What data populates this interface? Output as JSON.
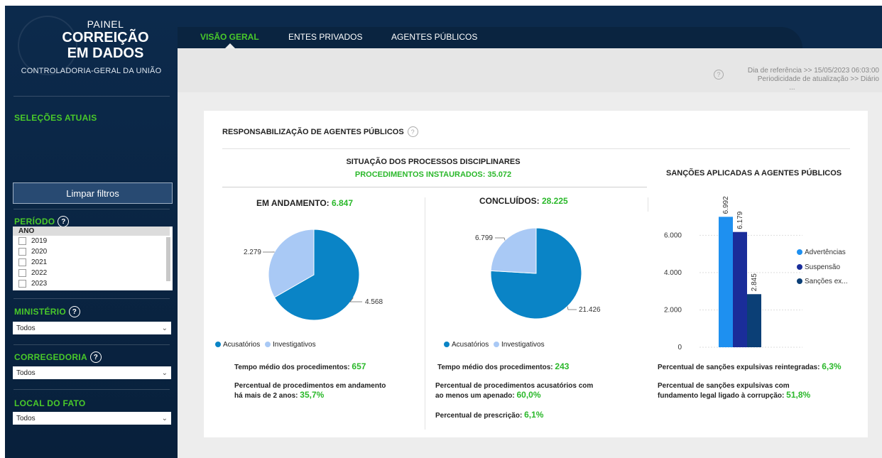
{
  "sidebar": {
    "brand_line1": "PAINEL",
    "brand_line2": "CORREIÇÃO",
    "brand_line3": "EM DADOS",
    "brand_line4": "CONTROLADORIA-GERAL DA UNIÃO",
    "selections_title": "SELEÇÕES ATUAIS",
    "clear_filters": "Limpar filtros",
    "periodo_title": "PERÍODO",
    "ano_header": "ANO",
    "years": [
      "2019",
      "2020",
      "2021",
      "2022",
      "2023"
    ],
    "ministerio_title": "MINISTÉRIO",
    "ministerio_value": "Todos",
    "corregedoria_title": "CORREGEDORIA",
    "corregedoria_value": "Todos",
    "local_title": "LOCAL DO FATO",
    "local_value": "Todos",
    "help_glyph": "?"
  },
  "nav": {
    "tabs": [
      "VISÃO GERAL",
      "ENTES PRIVADOS",
      "AGENTES PÚBLICOS"
    ],
    "active_tab": "VISÃO GERAL"
  },
  "reference": {
    "line1": "Dia de referência >> 15/05/2023 06:03:00",
    "line2": "Periodicidade de atualização >> Diário",
    "more": "..."
  },
  "card": {
    "title": "RESPONSABILIZAÇÃO DE AGENTES PÚBLICOS",
    "situacao_title": "SITUAÇÃO DOS PROCESSOS DISCIPLINARES",
    "instaurados": "PROCEDIMENTOS INSTAURADOS: 35.072",
    "em_andamento_label": "EM ANDAMENTO: ",
    "em_andamento_value": "6.847",
    "concluidos_label": "CONCLUÍDOS: ",
    "concluidos_value": "28.225",
    "legend_acusatorios": "Acusatórios",
    "legend_investigativos": "Investigativos",
    "andamento": {
      "tempo_label": "Tempo médio dos procedimentos: ",
      "tempo_value": "657",
      "perc_label_1": "Percentual de procedimentos em andamento",
      "perc_label_2": "há mais de 2 anos: ",
      "perc_value": "35,7%"
    },
    "concluidos": {
      "tempo_label": "Tempo médio dos procedimentos: ",
      "tempo_value": "243",
      "perc_label_1": "Percentual de procedimentos acusatórios com",
      "perc_label_2": "ao menos um apenado: ",
      "perc_value": "60,0%",
      "prescricao_label": "Percentual de prescrição: ",
      "prescricao_value": "6,1%"
    },
    "sancoes_title": "SANÇÕES APLICADAS A AGENTES PÚBLICOS",
    "sancoes": {
      "reint_label": "Percentual de sanções expulsivas reintegradas: ",
      "reint_value": "6,3%",
      "corr_label_1": "Percentual de sanções expulsivas com",
      "corr_label_2": "fundamento legal ligado à corrupção: ",
      "corr_value": "51,8%"
    }
  },
  "colors": {
    "acusatorios": "#0a84c6",
    "investigativos": "#a9c9f5",
    "advertencias": "#1e90f0",
    "suspensao": "#1a2d9a",
    "sancoes_ex": "#0b3f76",
    "green": "#2ab82a"
  },
  "chart_data": [
    {
      "type": "pie",
      "title": "EM ANDAMENTO: 6.847",
      "slices": [
        {
          "name": "Acusatórios",
          "value": 4568,
          "label": "4.568"
        },
        {
          "name": "Investigativos",
          "value": 2279,
          "label": "2.279"
        }
      ]
    },
    {
      "type": "pie",
      "title": "CONCLUÍDOS: 28.225",
      "slices": [
        {
          "name": "Acusatórios",
          "value": 21426,
          "label": "21.426"
        },
        {
          "name": "Investigativos",
          "value": 6799,
          "label": "6.799"
        }
      ]
    },
    {
      "type": "bar",
      "title": "SANÇÕES APLICADAS A AGENTES PÚBLICOS",
      "series": [
        {
          "name": "Advertências",
          "value": 6992,
          "label": "6.992"
        },
        {
          "name": "Suspensão",
          "value": 6179,
          "label": "6.179"
        },
        {
          "name": "Sanções ex...",
          "value": 2845,
          "label": "2.845"
        }
      ],
      "yticks": [
        0,
        2000,
        4000,
        6000
      ],
      "ytick_labels": [
        "0",
        "2.000",
        "4.000",
        "6.000"
      ],
      "ylim": [
        0,
        7500
      ],
      "legend": "right"
    }
  ]
}
